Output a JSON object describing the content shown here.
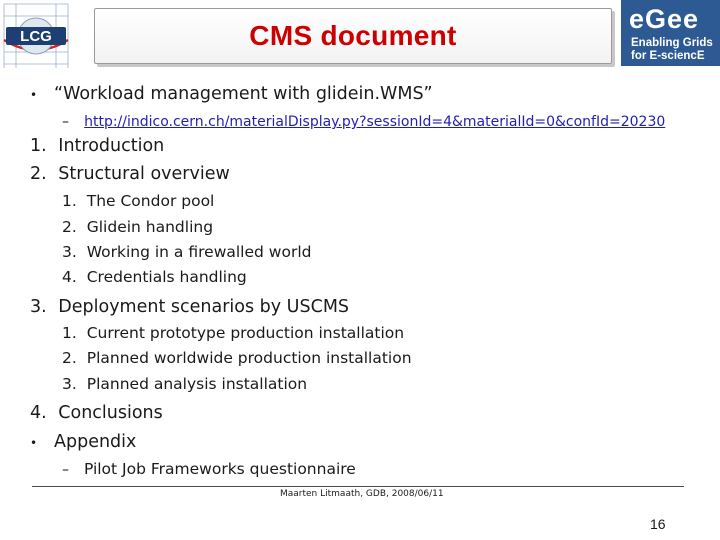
{
  "header": {
    "title": "CMS document",
    "lcg_logo_text": "LCG",
    "egee_word": "eGee",
    "egee_tagline_1": "Enabling Grids",
    "egee_tagline_2": "for E-sciencE",
    "colors": {
      "title": "#cc0000",
      "egee_bg": "#2e5a93",
      "link": "#1f1fb3"
    }
  },
  "content": {
    "bullet_1": "“Workload management with glidein.WMS”",
    "bullet_1_link": "http://indico.cern.ch/materialDisplay.py?sessionId=4&materialId=0&confId=20230",
    "items": [
      {
        "num": "1.",
        "text": "Introduction"
      },
      {
        "num": "2.",
        "text": "Structural overview"
      }
    ],
    "sub_2": [
      {
        "num": "1.",
        "text": "The Condor pool"
      },
      {
        "num": "2.",
        "text": "Glidein handling"
      },
      {
        "num": "3.",
        "text": "Working in a firewalled world"
      },
      {
        "num": "4.",
        "text": "Credentials handling"
      }
    ],
    "item_3": {
      "num": "3.",
      "text": "Deployment scenarios by USCMS"
    },
    "sub_3": [
      {
        "num": "1.",
        "text": "Current prototype production installation"
      },
      {
        "num": "2.",
        "text": "Planned worldwide production installation"
      },
      {
        "num": "3.",
        "text": "Planned analysis installation"
      }
    ],
    "item_4": {
      "num": "4.",
      "text": "Conclusions"
    },
    "appendix": "Appendix",
    "appendix_sub": "Pilot Job Frameworks questionnaire"
  },
  "footer": {
    "author": "Maarten Litmaath, GDB, 2008/06/11",
    "page": "16"
  }
}
